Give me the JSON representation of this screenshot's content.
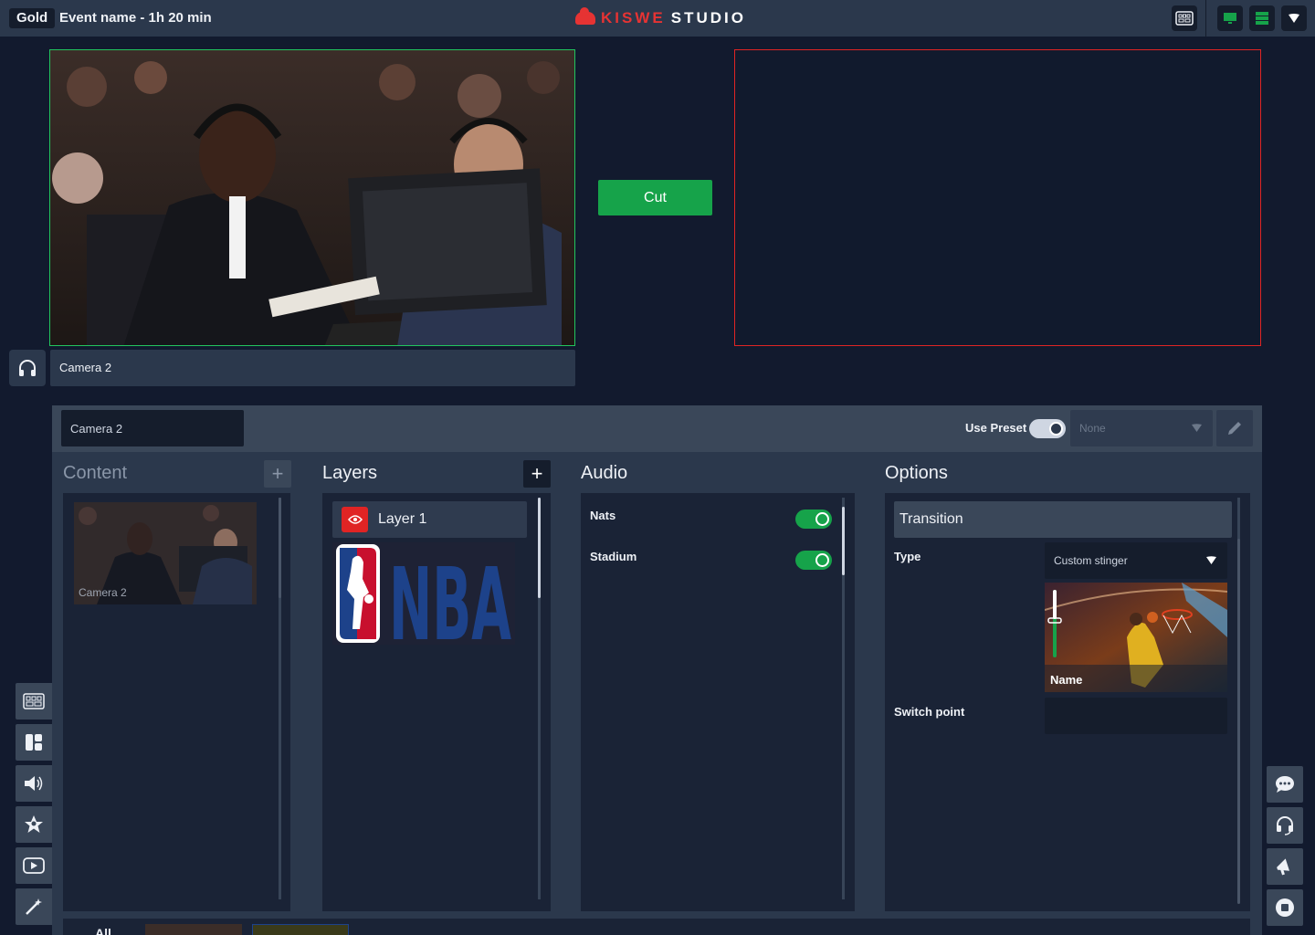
{
  "topbar": {
    "tier": "Gold",
    "event_title": "Event name - 1h 20 min",
    "logo_brand": "KISWE",
    "logo_product": "STUDIO",
    "logo_mark": "KISWE"
  },
  "icons": {
    "multiview": "multiview-icon",
    "monitor": "monitor-icon",
    "server": "server-icon",
    "dropdown": "chevron-down-icon",
    "headphones": "headphones-icon",
    "edit": "pencil-icon",
    "add": "plus-icon",
    "eye": "eye-icon"
  },
  "preview": {
    "source_label": "Camera 2"
  },
  "cut_button": "Cut",
  "panel": {
    "source_name": "Camera 2",
    "use_preset_label": "Use Preset",
    "use_preset_on": true,
    "preset_value": "None"
  },
  "content": {
    "title": "Content",
    "add": "+",
    "items": [
      {
        "label": "Camera 2"
      }
    ]
  },
  "layers": {
    "title": "Layers",
    "add": "+",
    "items": [
      {
        "name": "Layer 1",
        "logo_text": "NBA"
      }
    ]
  },
  "audio": {
    "title": "Audio",
    "channels": [
      {
        "name": "Nats",
        "on": true
      },
      {
        "name": "Stadium",
        "on": true
      }
    ]
  },
  "options": {
    "title": "Options",
    "section": "Transition",
    "type_label": "Type",
    "type_value": "Custom stinger",
    "stinger_name": "Name",
    "switch_point_label": "Switch point",
    "switch_point_value": ""
  },
  "bottom_strip": {
    "filter_label": "All"
  },
  "colors": {
    "accent_green": "#16a34a",
    "preview_border": "#22c55e",
    "program_border": "#e02424",
    "brand_red": "#e63333",
    "background": "#121a2e",
    "panel": "#2b384c"
  },
  "left_rail": [
    "multiview-icon",
    "layout-icon",
    "speaker-icon",
    "star-person-icon",
    "play-icon",
    "magic-wand-icon"
  ],
  "right_rail": [
    "chat-icon",
    "headset-icon",
    "megaphone-icon",
    "stop-icon"
  ]
}
